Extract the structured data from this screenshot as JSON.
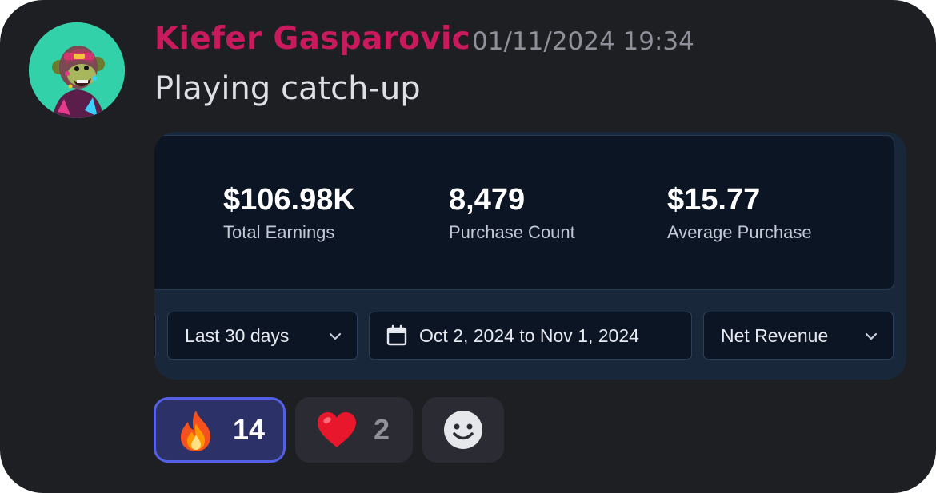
{
  "message": {
    "author": "Kiefer Gasparovic",
    "timestamp": "01/11/2024 19:34",
    "text": "Playing catch-up",
    "avatar_icon": "ape-avatar"
  },
  "embed": {
    "stats": [
      {
        "value": "$106.98K",
        "label": "Total Earnings"
      },
      {
        "value": "8,479",
        "label": "Purchase Count"
      },
      {
        "value": "$15.77",
        "label": "Average Purchase"
      }
    ],
    "controls": {
      "range_select": "Last 30 days",
      "date_range": "Oct 2, 2024 to Nov 1, 2024",
      "metric_select": "Net Revenue"
    }
  },
  "reactions": [
    {
      "emoji": "fire",
      "count": "14",
      "active": true
    },
    {
      "emoji": "heart",
      "count": "2",
      "active": false
    }
  ],
  "colors": {
    "author": "#c81a5c",
    "active_reaction_border": "#5360e6",
    "background": "#1e1f23"
  }
}
